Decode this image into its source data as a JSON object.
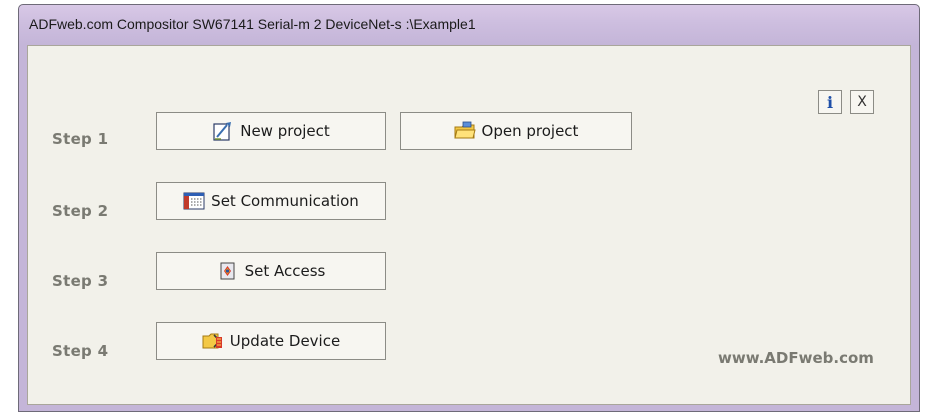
{
  "window": {
    "title": "ADFweb.com Compositor SW67141 Serial-m 2 DeviceNet-s :\\Example1"
  },
  "top_buttons": {
    "info_label": "i",
    "close_label": "X"
  },
  "steps": [
    {
      "label": "Step 1"
    },
    {
      "label": "Step 2"
    },
    {
      "label": "Step 3"
    },
    {
      "label": "Step 4"
    }
  ],
  "buttons": {
    "new_project": "New project",
    "open_project": "Open project",
    "set_communication": "Set Communication",
    "set_access": "Set Access",
    "update_device": "Update Device"
  },
  "footer": {
    "url": "www.ADFweb.com"
  },
  "colors": {
    "title_bar": "#cdbedf",
    "client_bg": "#f2f1ea",
    "info_blue": "#1f4fa8"
  }
}
